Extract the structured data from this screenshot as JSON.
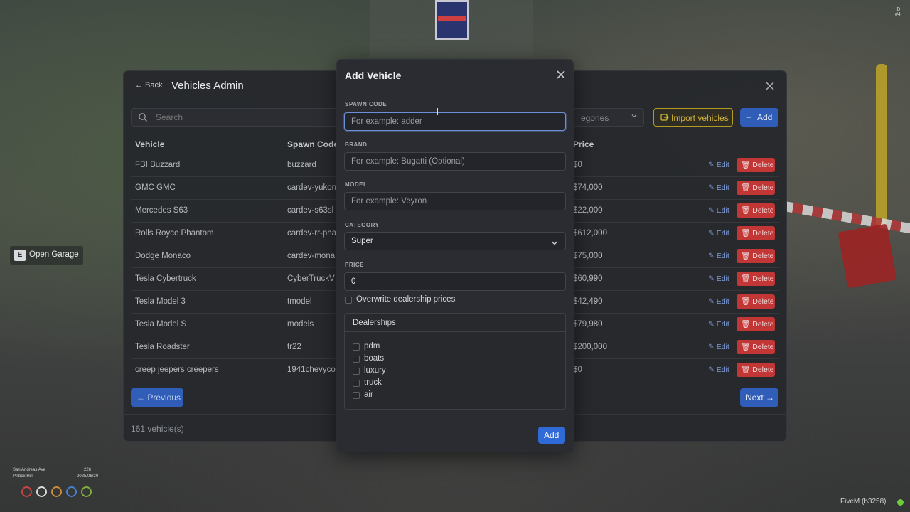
{
  "admin": {
    "back_label": "← Back",
    "title": "Vehicles Admin",
    "search_placeholder": "Search",
    "category_placeholder": "egories",
    "import_label": "Import vehicles",
    "add_label": "Add",
    "columns": {
      "vehicle": "Vehicle",
      "spawn_code": "Spawn Code",
      "price": "Price"
    },
    "rows": [
      {
        "vehicle": "FBI Buzzard",
        "spawn_code": "buzzard",
        "price": "$0"
      },
      {
        "vehicle": "GMC GMC",
        "spawn_code": "cardev-yukon",
        "price": "$74,000"
      },
      {
        "vehicle": "Mercedes S63",
        "spawn_code": "cardev-s63sl",
        "price": "$22,000"
      },
      {
        "vehicle": "Rolls Royce Phantom",
        "spawn_code": "cardev-rr-pha",
        "price": "$612,000"
      },
      {
        "vehicle": "Dodge Monaco",
        "spawn_code": "cardev-mona",
        "price": "$75,000"
      },
      {
        "vehicle": "Tesla Cybertruck",
        "spawn_code": "CyberTruckV",
        "price": "$60,990"
      },
      {
        "vehicle": "Tesla Model 3",
        "spawn_code": "tmodel",
        "price": "$42,490"
      },
      {
        "vehicle": "Tesla Model S",
        "spawn_code": "models",
        "price": "$79,980"
      },
      {
        "vehicle": "Tesla Roadster",
        "spawn_code": "tr22",
        "price": "$200,000"
      },
      {
        "vehicle": "creep jeepers creepers",
        "spawn_code": "1941chevycoe",
        "price": "$0"
      }
    ],
    "edit_label": "✎ Edit",
    "delete_label": "🗑 Delete",
    "prev_label": "← Previous",
    "next_label": "Next →",
    "count_text": "161 vehicle(s)"
  },
  "modal": {
    "title": "Add Vehicle",
    "spawn_code_label": "SPAWN CODE",
    "spawn_code_placeholder": "For example: adder",
    "brand_label": "BRAND",
    "brand_placeholder": "For example: Bugatti (Optional)",
    "model_label": "MODEL",
    "model_placeholder": "For example: Veyron",
    "category_label": "CATEGORY",
    "category_value": "Super",
    "price_label": "PRICE",
    "price_value": "0",
    "overwrite_label": "Overwrite dealership prices",
    "dealerships_title": "Dealerships",
    "dealerships": [
      "pdm",
      "boats",
      "luxury",
      "truck",
      "air"
    ],
    "submit_label": "Add"
  },
  "hud": {
    "garage_key": "E",
    "garage_label": "Open Garage",
    "street": "San Andreas Ave",
    "area": "Pillbox Hill",
    "heading_value": "226",
    "date": "2025/06/20",
    "id_label": "ID",
    "id_value": "#4",
    "fivem_text": "FiveM (b3258)"
  },
  "colors": {
    "accent_blue": "#2f5db8",
    "danger_red": "#c23636",
    "warning_gold": "#d2b73a"
  }
}
